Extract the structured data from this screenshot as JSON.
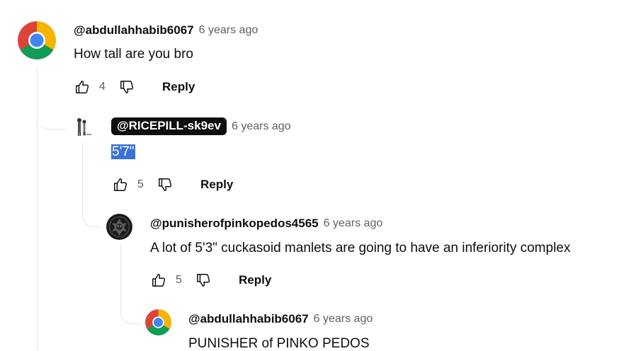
{
  "comments": [
    {
      "author": "@abdullahhabib6067",
      "time": "6 years ago",
      "text": "How tall are you bro",
      "likes": "4",
      "reply_label": "Reply",
      "avatar_icon": "chrome-logo-avatar"
    },
    {
      "author": "@RICEPILL-sk9ev",
      "time": "6 years ago",
      "text": "5'7\"",
      "likes": "5",
      "reply_label": "Reply",
      "avatar_icon": "figures-avatar"
    },
    {
      "author": "@punisherofpinkopedos4565",
      "time": "6 years ago",
      "text": "A lot of 5'3\" cuckasoid manlets are going to have an inferiority complex",
      "likes": "5",
      "reply_label": "Reply",
      "avatar_icon": "dark-emblem-avatar"
    },
    {
      "author": "@abdullahhabib6067",
      "time": "6 years ago",
      "text": "PUNISHER of PINKO PEDOS",
      "avatar_icon": "chrome-logo-avatar"
    }
  ],
  "icons": {
    "like": "thumbs-up-icon",
    "dislike": "thumbs-down-icon"
  },
  "colors": {
    "text": "#0f0f0f",
    "meta": "#606060",
    "selection": "#3a73d6",
    "thread_line": "#e5e5e5"
  }
}
